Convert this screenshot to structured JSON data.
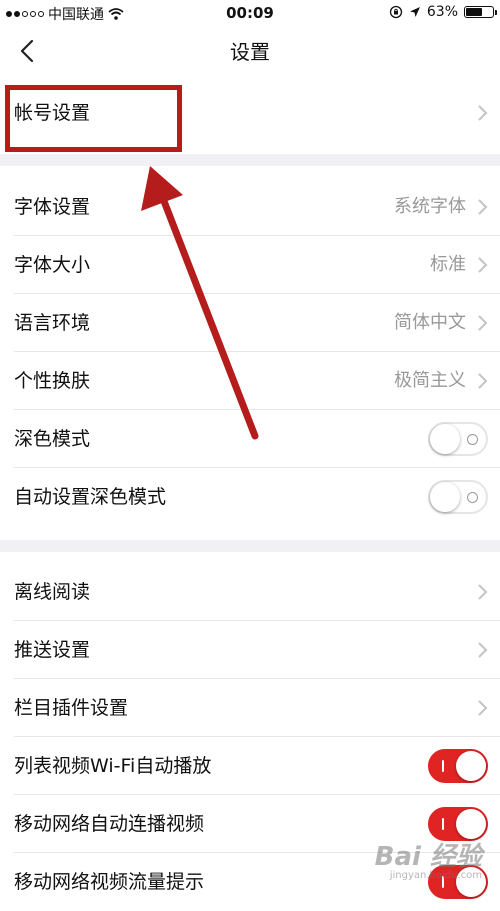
{
  "status_bar": {
    "carrier": "中国联通",
    "time": "00:09",
    "battery": "63%",
    "signal_strength": 2,
    "battery_level": 0.63
  },
  "nav": {
    "title": "设置"
  },
  "account": {
    "label": "帐号设置"
  },
  "display": {
    "font_label": "字体设置",
    "font_value": "系统字体",
    "size_label": "字体大小",
    "size_value": "标准",
    "lang_label": "语言环境",
    "lang_value": "简体中文",
    "skin_label": "个性换肤",
    "skin_value": "极简主义",
    "dark_label": "深色模式",
    "dark_on": false,
    "auto_dark_label": "自动设置深色模式",
    "auto_dark_on": false
  },
  "other": {
    "offline_label": "离线阅读",
    "push_label": "推送设置",
    "plugin_label": "栏目插件设置",
    "wifi_autoplay_label": "列表视频Wi-Fi自动播放",
    "wifi_autoplay_on": true,
    "mobile_autoplay_label": "移动网络自动连播视频",
    "mobile_autoplay_on": true,
    "mobile_traffic_label": "移动网络视频流量提示",
    "mobile_traffic_on": true
  },
  "watermark": {
    "main": "Bai 经验",
    "sub": "jingyan.baidu.com"
  },
  "colors": {
    "accent_red": "#e02424",
    "annotation_red": "#b51c1c",
    "value_gray": "#999999",
    "section_gap": "#f0f0f5"
  }
}
